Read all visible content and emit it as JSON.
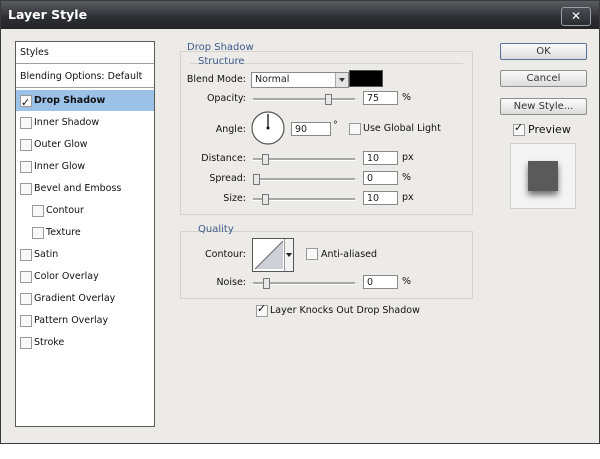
{
  "window": {
    "title": "Layer Style",
    "close_symbol": "✕"
  },
  "styles_list": {
    "header": "Styles",
    "blending_options": "Blending Options: Default",
    "items": [
      {
        "label": "Drop Shadow",
        "checked": true,
        "selected": true
      },
      {
        "label": "Inner Shadow",
        "checked": false
      },
      {
        "label": "Outer Glow",
        "checked": false
      },
      {
        "label": "Inner Glow",
        "checked": false
      },
      {
        "label": "Bevel and Emboss",
        "checked": false
      },
      {
        "label": "Contour",
        "checked": false,
        "sub": true
      },
      {
        "label": "Texture",
        "checked": false,
        "sub": true
      },
      {
        "label": "Satin",
        "checked": false
      },
      {
        "label": "Color Overlay",
        "checked": false
      },
      {
        "label": "Gradient Overlay",
        "checked": false
      },
      {
        "label": "Pattern Overlay",
        "checked": false
      },
      {
        "label": "Stroke",
        "checked": false
      }
    ]
  },
  "drop_shadow": {
    "group_title": "Drop Shadow",
    "structure": {
      "title": "Structure",
      "blend_mode_label": "Blend Mode:",
      "blend_mode_value": "Normal",
      "shadow_color": "#000000",
      "opacity_label": "Opacity:",
      "opacity_value": "75",
      "opacity_unit": "%",
      "opacity_fraction": 0.75,
      "angle_label": "Angle:",
      "angle_value": "90",
      "angle_unit": "°",
      "use_global_light_label": "Use Global Light",
      "use_global_light_checked": false,
      "distance_label": "Distance:",
      "distance_value": "10",
      "distance_unit": "px",
      "spread_label": "Spread:",
      "spread_value": "0",
      "spread_unit": "%",
      "size_label": "Size:",
      "size_value": "10",
      "size_unit": "px"
    },
    "quality": {
      "title": "Quality",
      "contour_label": "Contour:",
      "anti_aliased_label": "Anti-aliased",
      "anti_aliased_checked": false,
      "noise_label": "Noise:",
      "noise_value": "0",
      "noise_unit": "%"
    },
    "knockout_label": "Layer Knocks Out Drop Shadow",
    "knockout_checked": true
  },
  "buttons": {
    "ok": "OK",
    "cancel": "Cancel",
    "new_style": "New Style..."
  },
  "preview": {
    "label": "Preview",
    "checked": true
  }
}
